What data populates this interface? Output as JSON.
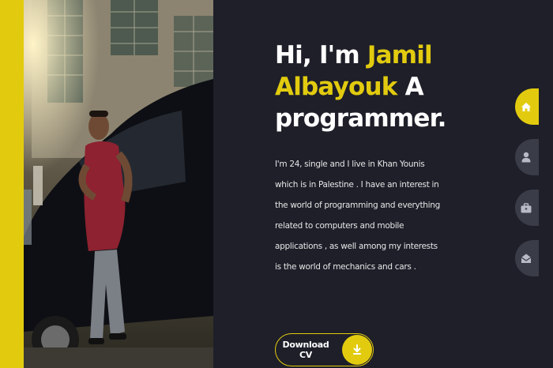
{
  "hero": {
    "greeting": "Hi, I'm",
    "first_name": "Jamil",
    "last_name": "Albayouk",
    "role_prefix": "A",
    "role": "programmer.",
    "bio": "I'm 24, single and I live in Khan Younis which is in Palestine . I have an interest in the world of programming and everything related to computers and mobile applications , as well among my interests is the world of mechanics and cars ."
  },
  "cv_button": {
    "label": "Download CV",
    "icon": "download-icon"
  },
  "nav": {
    "items": [
      {
        "icon": "home-icon",
        "active": true
      },
      {
        "icon": "user-icon",
        "active": false
      },
      {
        "icon": "briefcase-icon",
        "active": false
      },
      {
        "icon": "envelope-open-icon",
        "active": false
      }
    ]
  },
  "colors": {
    "accent": "#e2cb0f",
    "background": "#1e1f29",
    "nav_inactive": "#3a3c48",
    "text": "#ffffff"
  }
}
